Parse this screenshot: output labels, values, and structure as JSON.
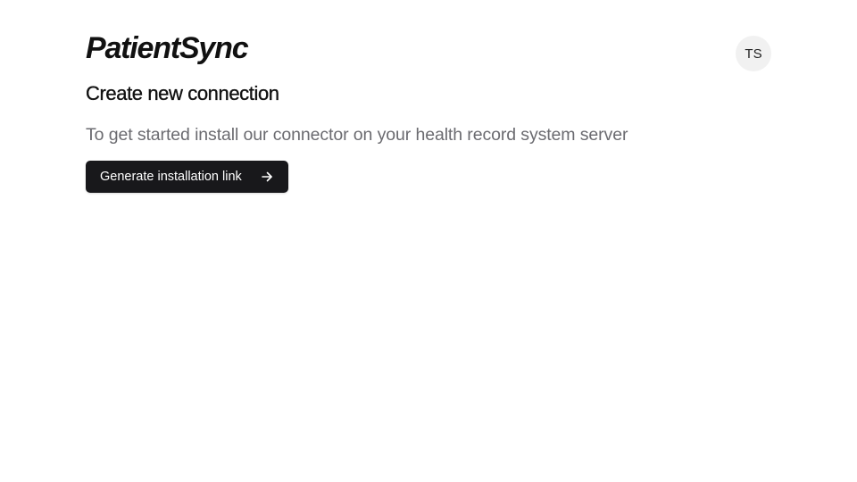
{
  "header": {
    "brand": "PatientSync",
    "avatar_initials": "TS"
  },
  "main": {
    "title": "Create new connection",
    "subtitle": "To get started install our connector on your health record system server",
    "cta_label": "Generate installation link",
    "cta_icon": "arrow-right-icon"
  },
  "colors": {
    "button_background": "#18181b",
    "subtitle_text": "#6b6b70",
    "avatar_background": "#f1f1f1"
  }
}
